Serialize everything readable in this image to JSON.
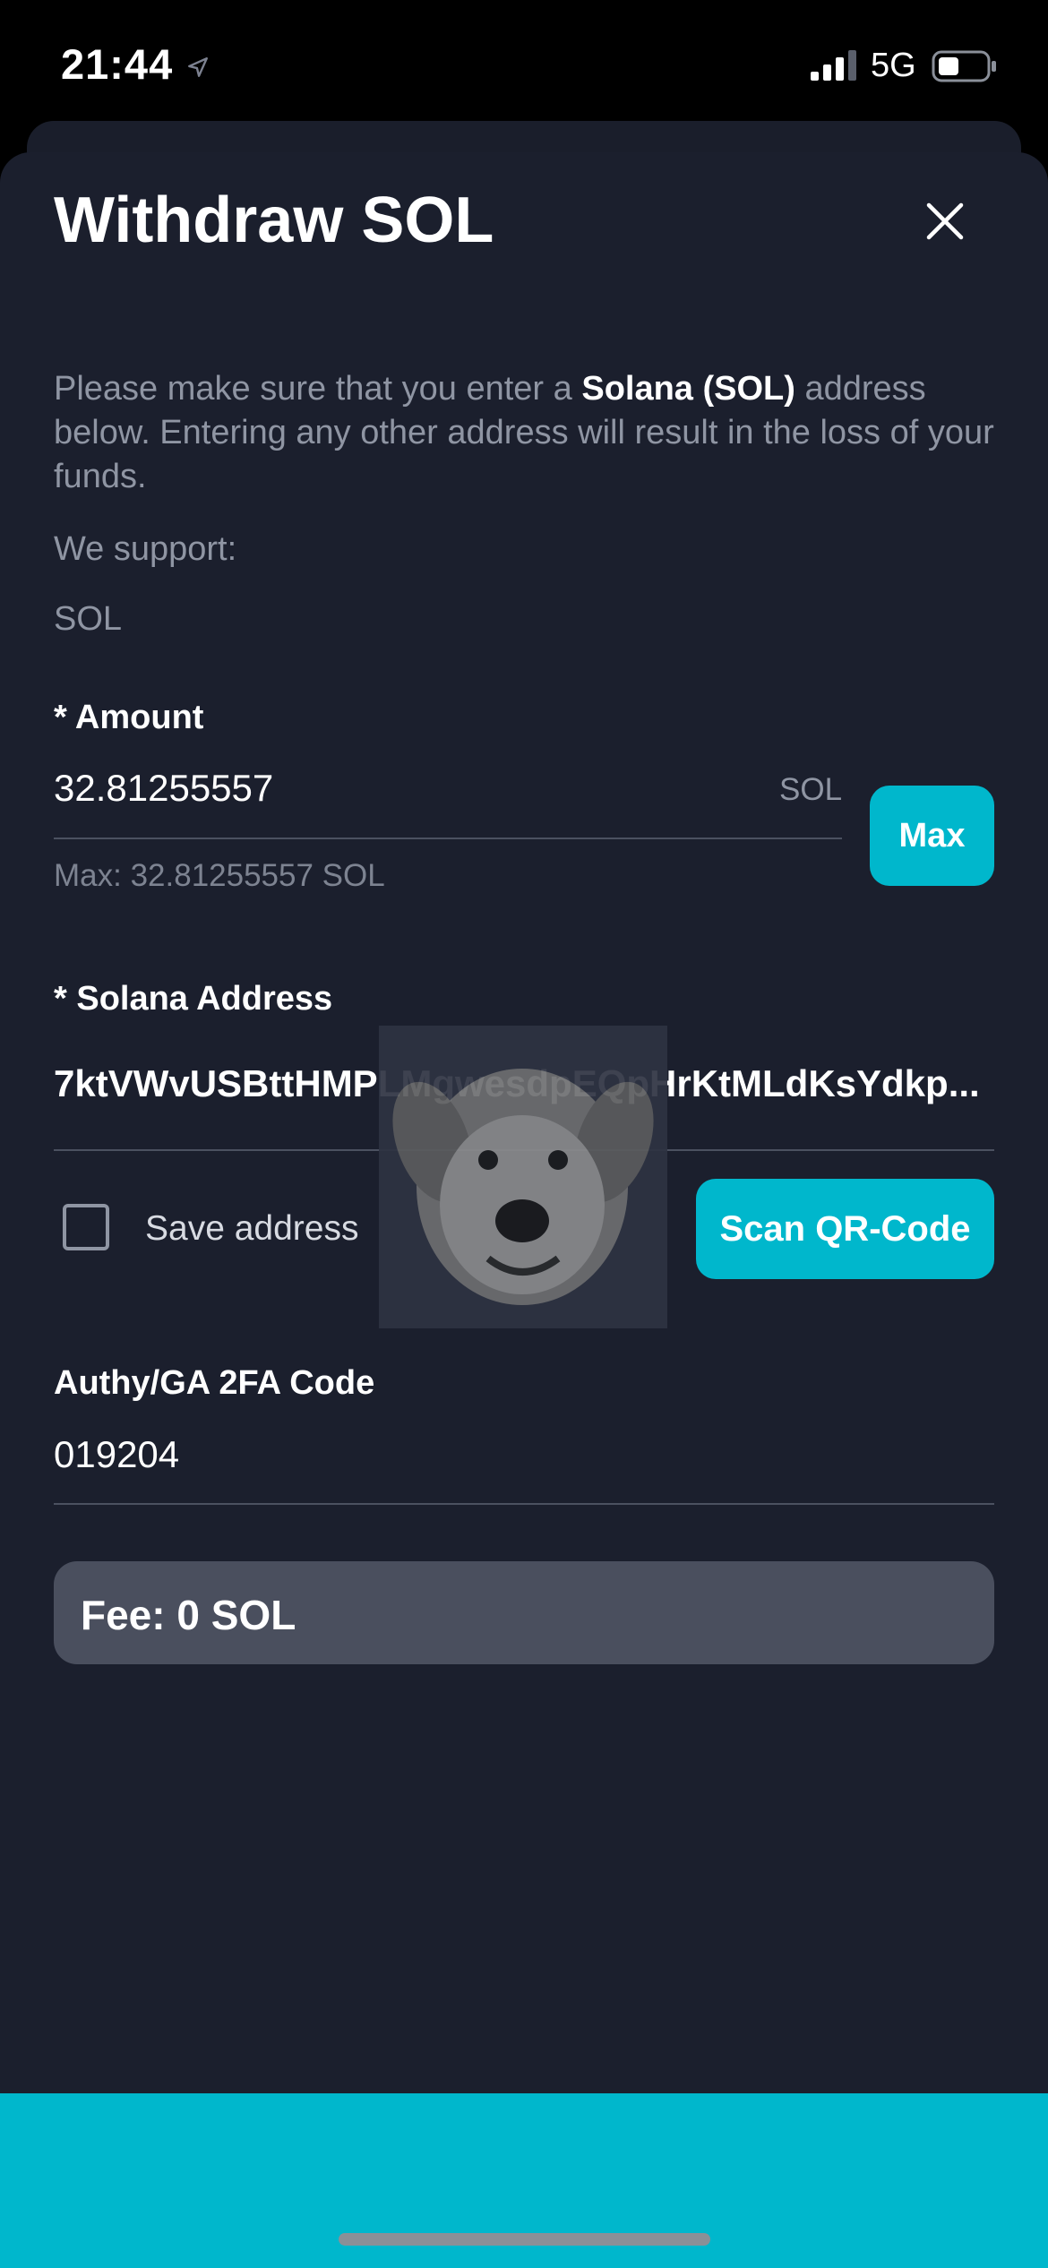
{
  "status_bar": {
    "time": "21:44",
    "network": "5G",
    "icons": [
      "location-arrow-icon",
      "signal-bars-icon",
      "battery-icon"
    ]
  },
  "modal": {
    "title": "Withdraw SOL",
    "close_icon": "close-icon",
    "info_prefix": "Please make sure that you enter a ",
    "info_highlight": "Solana (SOL)",
    "info_suffix": " address below. Entering any other address will result in the loss of your funds.",
    "support_label": "We support:",
    "support_value": "SOL"
  },
  "amount": {
    "label": "* Amount",
    "value": "32.81255557",
    "unit": "SOL",
    "hint": "Max: 32.81255557 SOL",
    "max_button": "Max"
  },
  "address": {
    "label": "* Solana Address",
    "value": "7ktVWvUSBttHMPLMgwesdpEQpHrKtMLdKsYdkp...",
    "save_label": "Save address",
    "save_checked": false,
    "scan_button": "Scan QR-Code"
  },
  "twofa": {
    "label": "Authy/GA 2FA Code",
    "value": "019204"
  },
  "fee": {
    "text": "Fee: 0 SOL"
  },
  "colors": {
    "accent": "#00b7cc",
    "background": "#1b1f2d",
    "fee_box": "#4a4f5e",
    "muted_text": "#8f95a3"
  }
}
